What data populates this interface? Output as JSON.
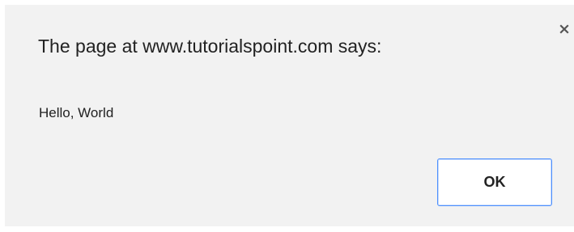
{
  "dialog": {
    "title": "The page at www.tutorialspoint.com says:",
    "message": "Hello, World",
    "ok_label": "OK",
    "close_icon": "close-icon"
  }
}
